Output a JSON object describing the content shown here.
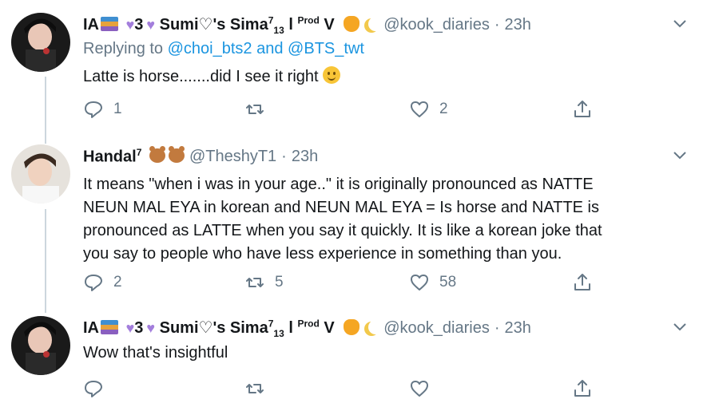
{
  "tweets": [
    {
      "name_prefix": "IA",
      "name_mid": "3",
      "name_main": "Sumi♡'s Sima",
      "name_sup": "7",
      "name_sub": "13",
      "name_tail": "l",
      "name_sup2": "Prod",
      "name_tail2": "V",
      "handle": "@kook_diaries",
      "dot": "·",
      "time": "23h",
      "replying_label": "Replying to",
      "replying_1": "@choi_bts2",
      "replying_and": "and",
      "replying_2": "@BTS_twt",
      "text": "Latte is horse.......did I see it right",
      "reply_count": "1",
      "retweet_count": "",
      "like_count": "2"
    },
    {
      "name_main": "Handal",
      "name_sup": "7",
      "handle": "@TheshyT1",
      "dot": "·",
      "time": "23h",
      "text_lines": [
        "It means \"when i was in your age..\" it is originally pronounced as NATTE",
        "NEUN MAL EYA in korean and NEUN MAL EYA = Is horse and NATTE is",
        "pronounced as LATTE when you say it quickly. It is like a korean joke that",
        "you say to people who have less experience in something than you."
      ],
      "reply_count": "2",
      "retweet_count": "5",
      "like_count": "58"
    },
    {
      "name_prefix": "IA",
      "name_mid": "3",
      "name_main": "Sumi♡'s Sima",
      "name_sup": "7",
      "name_sub": "13",
      "name_tail": "l",
      "name_sup2": "Prod",
      "name_tail2": "V",
      "handle": "@kook_diaries",
      "dot": "·",
      "time": "23h",
      "text": "Wow that's insightful",
      "reply_count": "",
      "retweet_count": "",
      "like_count": ""
    }
  ],
  "icons": {
    "reply": "reply-icon",
    "retweet": "retweet-icon",
    "like": "heart-icon",
    "share": "share-icon",
    "more": "chevron-down-icon"
  },
  "colors": {
    "link": "#1b95e0",
    "muted": "#657786",
    "thread_line": "#ccd6dd"
  }
}
